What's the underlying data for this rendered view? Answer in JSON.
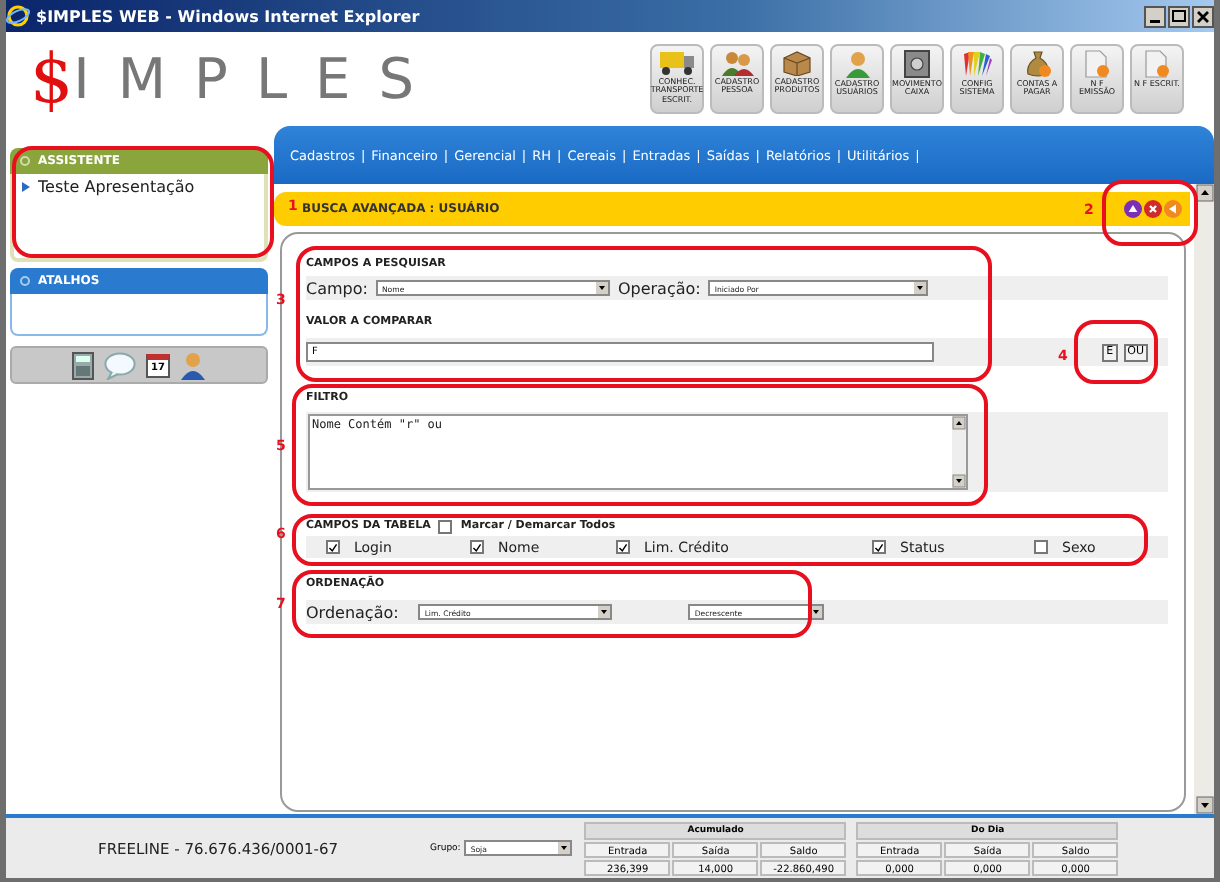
{
  "window": {
    "title": "$IMPLES WEB - Windows Internet Explorer"
  },
  "logo": {
    "symbol": "$",
    "text": "IMPLES"
  },
  "toolbar": [
    {
      "kind": "truck",
      "label": "CONHEC. TRANSPORTE ESCRIT."
    },
    {
      "kind": "people",
      "label": "CADASTRO PESSOA"
    },
    {
      "kind": "box",
      "label": "CADASTRO PRODUTOS"
    },
    {
      "kind": "person",
      "label": "CADASTRO USUÁRIOS"
    },
    {
      "kind": "safe",
      "label": "MOVIMENTO CAIXA"
    },
    {
      "kind": "palette",
      "label": "CONFIG SISTEMA"
    },
    {
      "kind": "money",
      "label": "CONTAS A PAGAR"
    },
    {
      "kind": "document",
      "label": "N F EMISSÃO"
    },
    {
      "kind": "document",
      "label": "N F ESCRIT."
    }
  ],
  "sidebar": {
    "assistente": {
      "title": "ASSISTENTE",
      "items": [
        "Teste Apresentação"
      ]
    },
    "atalhos": {
      "title": "ATALHOS"
    },
    "calendar_day": "17"
  },
  "menu": {
    "separator": "|",
    "items": [
      "Cadastros",
      "Financeiro",
      "Gerencial",
      "RH",
      "Cereais",
      "Entradas",
      "Saídas",
      "Relatórios",
      "Utilitários"
    ]
  },
  "page_title": "BUSCA AVANÇADA : USUÁRIO",
  "campos_pesquisar": {
    "title": "CAMPOS A PESQUISAR",
    "campo_label": "Campo:",
    "campo_value": "Nome",
    "operacao_label": "Operação:",
    "operacao_value": "Iniciado Por"
  },
  "valor_comparar": {
    "title": "VALOR A COMPARAR",
    "value": "F",
    "buttons": [
      "E",
      "OU"
    ]
  },
  "filtro": {
    "title": "FILTRO",
    "value": "Nome Contém \"r\" ou"
  },
  "campos_tabela": {
    "title": "CAMPOS DA TABELA",
    "mark_all": {
      "label": "Marcar / Demarcar Todos",
      "checked": false
    },
    "fields": [
      {
        "label": "Login",
        "checked": true
      },
      {
        "label": "Nome",
        "checked": true
      },
      {
        "label": "Lim. Crédito",
        "checked": true
      },
      {
        "label": "Status",
        "checked": true
      },
      {
        "label": "Sexo",
        "checked": false
      }
    ]
  },
  "ordenacao": {
    "title": "ORDENAÇÃO",
    "label": "Ordenação:",
    "field": "Lim. Crédito",
    "direction": "Decrescente"
  },
  "footer": {
    "company": "FREELINE - 76.676.436/0001-67",
    "grupo_label": "Grupo:",
    "grupo_value": "Soja",
    "totals": [
      {
        "title": "Acumulado",
        "columns": [
          "Entrada",
          "Saída",
          "Saldo"
        ],
        "values": [
          "236,399",
          "14,000",
          "-22.860,490"
        ]
      },
      {
        "title": "Do Dia",
        "columns": [
          "Entrada",
          "Saída",
          "Saldo"
        ],
        "values": [
          "0,000",
          "0,000",
          "0,000"
        ]
      }
    ]
  },
  "annotations": [
    {
      "kind": "outline"
    },
    {
      "kind": "number",
      "label": "1"
    },
    {
      "kind": "numbered_outline",
      "label": "2"
    },
    {
      "kind": "numbered_outline",
      "label": "3"
    },
    {
      "kind": "numbered_outline",
      "label": "4"
    },
    {
      "kind": "numbered_outline",
      "label": "5"
    },
    {
      "kind": "numbered_outline",
      "label": "6"
    },
    {
      "kind": "numbered_outline",
      "label": "7"
    }
  ]
}
